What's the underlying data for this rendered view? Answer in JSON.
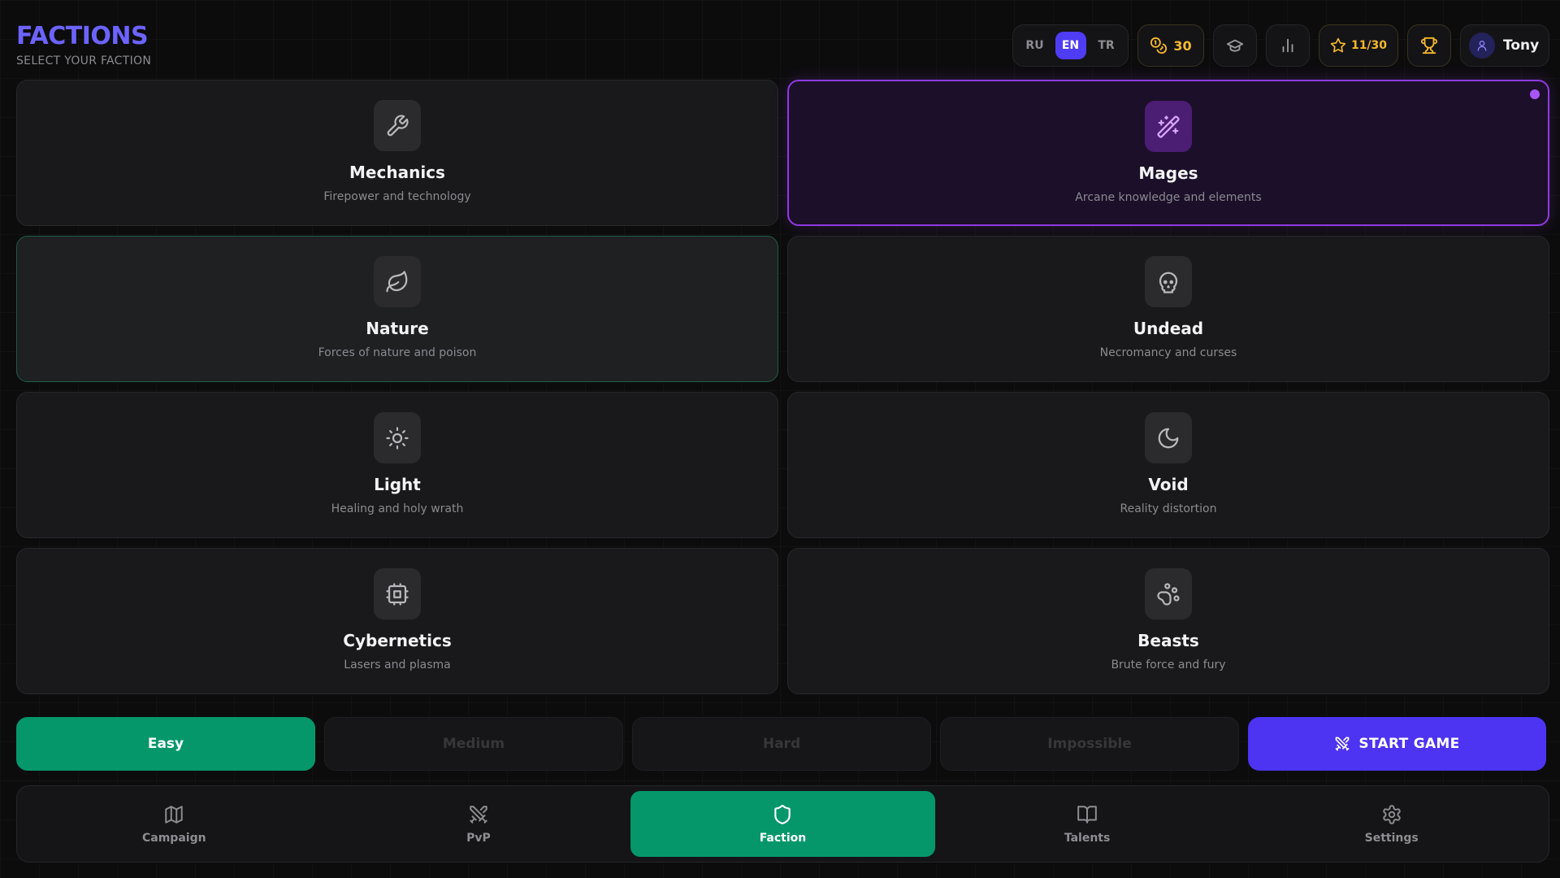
{
  "header": {
    "title": "FACTIONS",
    "subtitle": "SELECT YOUR FACTION"
  },
  "topbar": {
    "languages": [
      {
        "label": "RU",
        "active": false
      },
      {
        "label": "EN",
        "active": true
      },
      {
        "label": "TR",
        "active": false
      }
    ],
    "coins": "30",
    "stars": "11/30",
    "username": "Tony"
  },
  "factions": [
    {
      "name": "Mechanics",
      "desc": "Firepower and technology",
      "icon": "wrench-icon",
      "state": "normal"
    },
    {
      "name": "Mages",
      "desc": "Arcane knowledge and elements",
      "icon": "magic-wand-icon",
      "state": "selected"
    },
    {
      "name": "Nature",
      "desc": "Forces of nature and poison",
      "icon": "leaf-icon",
      "state": "hovered"
    },
    {
      "name": "Undead",
      "desc": "Necromancy and curses",
      "icon": "skull-icon",
      "state": "normal"
    },
    {
      "name": "Light",
      "desc": "Healing and holy wrath",
      "icon": "sun-icon",
      "state": "normal"
    },
    {
      "name": "Void",
      "desc": "Reality distortion",
      "icon": "moon-icon",
      "state": "normal"
    },
    {
      "name": "Cybernetics",
      "desc": "Lasers and plasma",
      "icon": "cpu-icon",
      "state": "normal"
    },
    {
      "name": "Beasts",
      "desc": "Brute force and fury",
      "icon": "paw-icon",
      "state": "normal"
    }
  ],
  "difficulty": {
    "options": [
      "Easy",
      "Medium",
      "Hard",
      "Impossible"
    ],
    "selected": "Easy"
  },
  "start_button": "START GAME",
  "nav": [
    {
      "label": "Campaign",
      "icon": "map-icon",
      "active": false
    },
    {
      "label": "PvP",
      "icon": "crossed-swords-icon",
      "active": false
    },
    {
      "label": "Faction",
      "icon": "shield-icon",
      "active": true
    },
    {
      "label": "Talents",
      "icon": "book-icon",
      "active": false
    },
    {
      "label": "Settings",
      "icon": "gear-icon",
      "active": false
    }
  ],
  "colors": {
    "accent_purple": "#6c63ff",
    "selected_border": "#8e3ae0",
    "green": "#05976a",
    "start": "#4d34f2",
    "gold": "#f5b82e"
  }
}
